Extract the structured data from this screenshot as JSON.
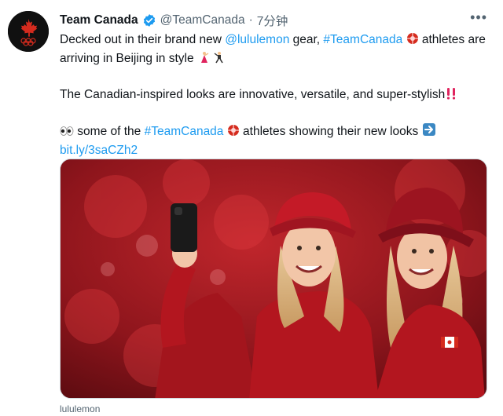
{
  "account": {
    "name": "Team Canada",
    "handle": "@TeamCanada",
    "separator": "·",
    "time": "7分钟",
    "avatar_icon": "maple-leaf-olympic-rings-icon",
    "verified_icon": "verified-badge-icon"
  },
  "tweet": {
    "line1_pre": "Decked out in their brand new ",
    "mention": "@lululemon",
    "line1_mid": " gear, ",
    "hashtag1": "#TeamCanada",
    "line1_post": " athletes are arriving in Beijing in style",
    "line2": "The Canadian-inspired looks are innovative, versatile, and super-stylish",
    "line3_pre": " some of the ",
    "hashtag2": "#TeamCanada",
    "line3_post": " athletes showing their new looks ",
    "link": "bit.ly/3saCZh2"
  },
  "media": {
    "description_icon": "photo-two-athletes-selfie",
    "source_label": "lululemon"
  },
  "colors": {
    "link": "#1d9bf0",
    "text": "#0f1419",
    "muted": "#536471",
    "team_red": "#d52b1e"
  }
}
